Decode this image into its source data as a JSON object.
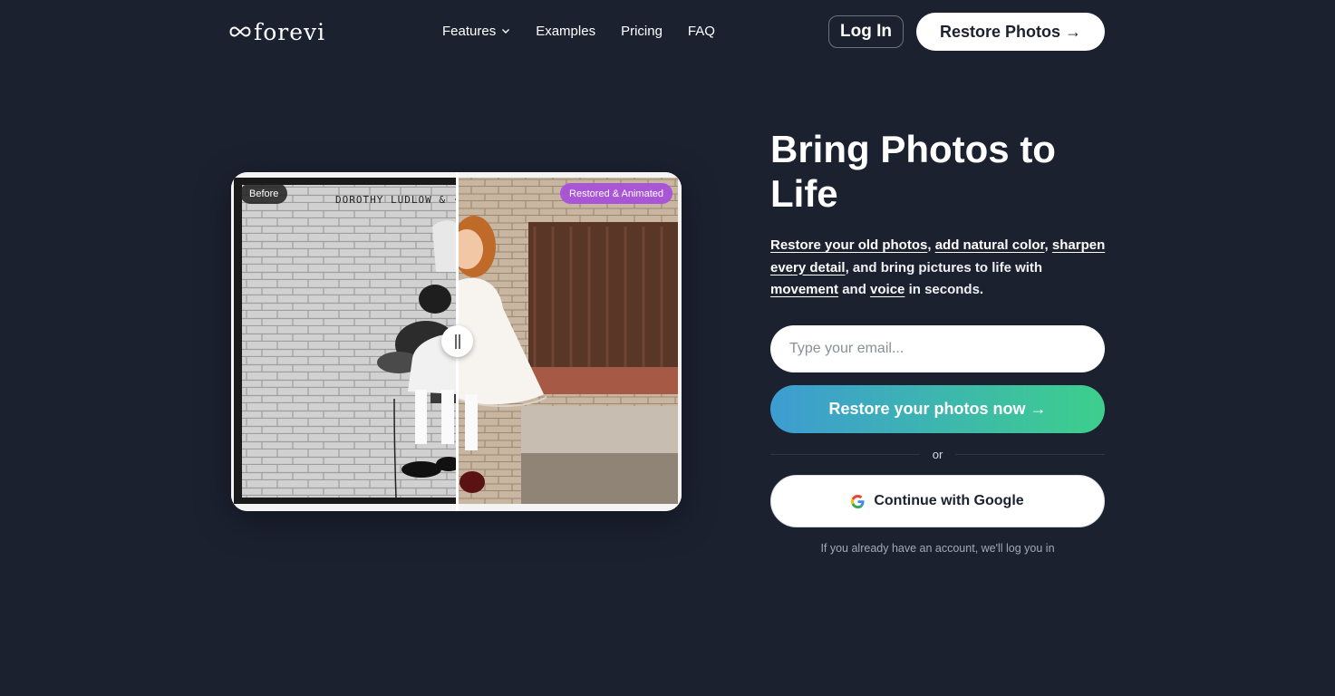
{
  "header": {
    "logo_text": "forevi",
    "logo_icon": "infinity-icon",
    "nav": [
      {
        "label": "Features",
        "has_dropdown": true
      },
      {
        "label": "Examples"
      },
      {
        "label": "Pricing"
      },
      {
        "label": "FAQ"
      }
    ],
    "login_label": "Log In",
    "restore_label": "Restore Photos →"
  },
  "compare": {
    "before_label": "Before",
    "after_label": "Restored & Animated",
    "split_percent": 50
  },
  "hero": {
    "title": "Bring Photos to Life",
    "subtitle": {
      "link1": "Restore your old photos",
      "sep1": ", ",
      "link2": "add natural color",
      "sep2": ", ",
      "link3": "sharpen every detail",
      "text1": ", and bring pictures to life with ",
      "link4": "movement",
      "text2": " and ",
      "link5": "voice",
      "text3": " in seconds."
    }
  },
  "form": {
    "email_placeholder": "Type your email...",
    "email_value": "",
    "cta_label": "Restore your photos now →",
    "or_label": "or",
    "google_label": "Continue with Google",
    "note": "If you already have an account, we'll log you in"
  },
  "colors": {
    "background": "#1c2130",
    "cta_gradient_start": "#3d9cd2",
    "cta_gradient_end": "#3dcf8c",
    "after_badge": "#a855d6"
  }
}
